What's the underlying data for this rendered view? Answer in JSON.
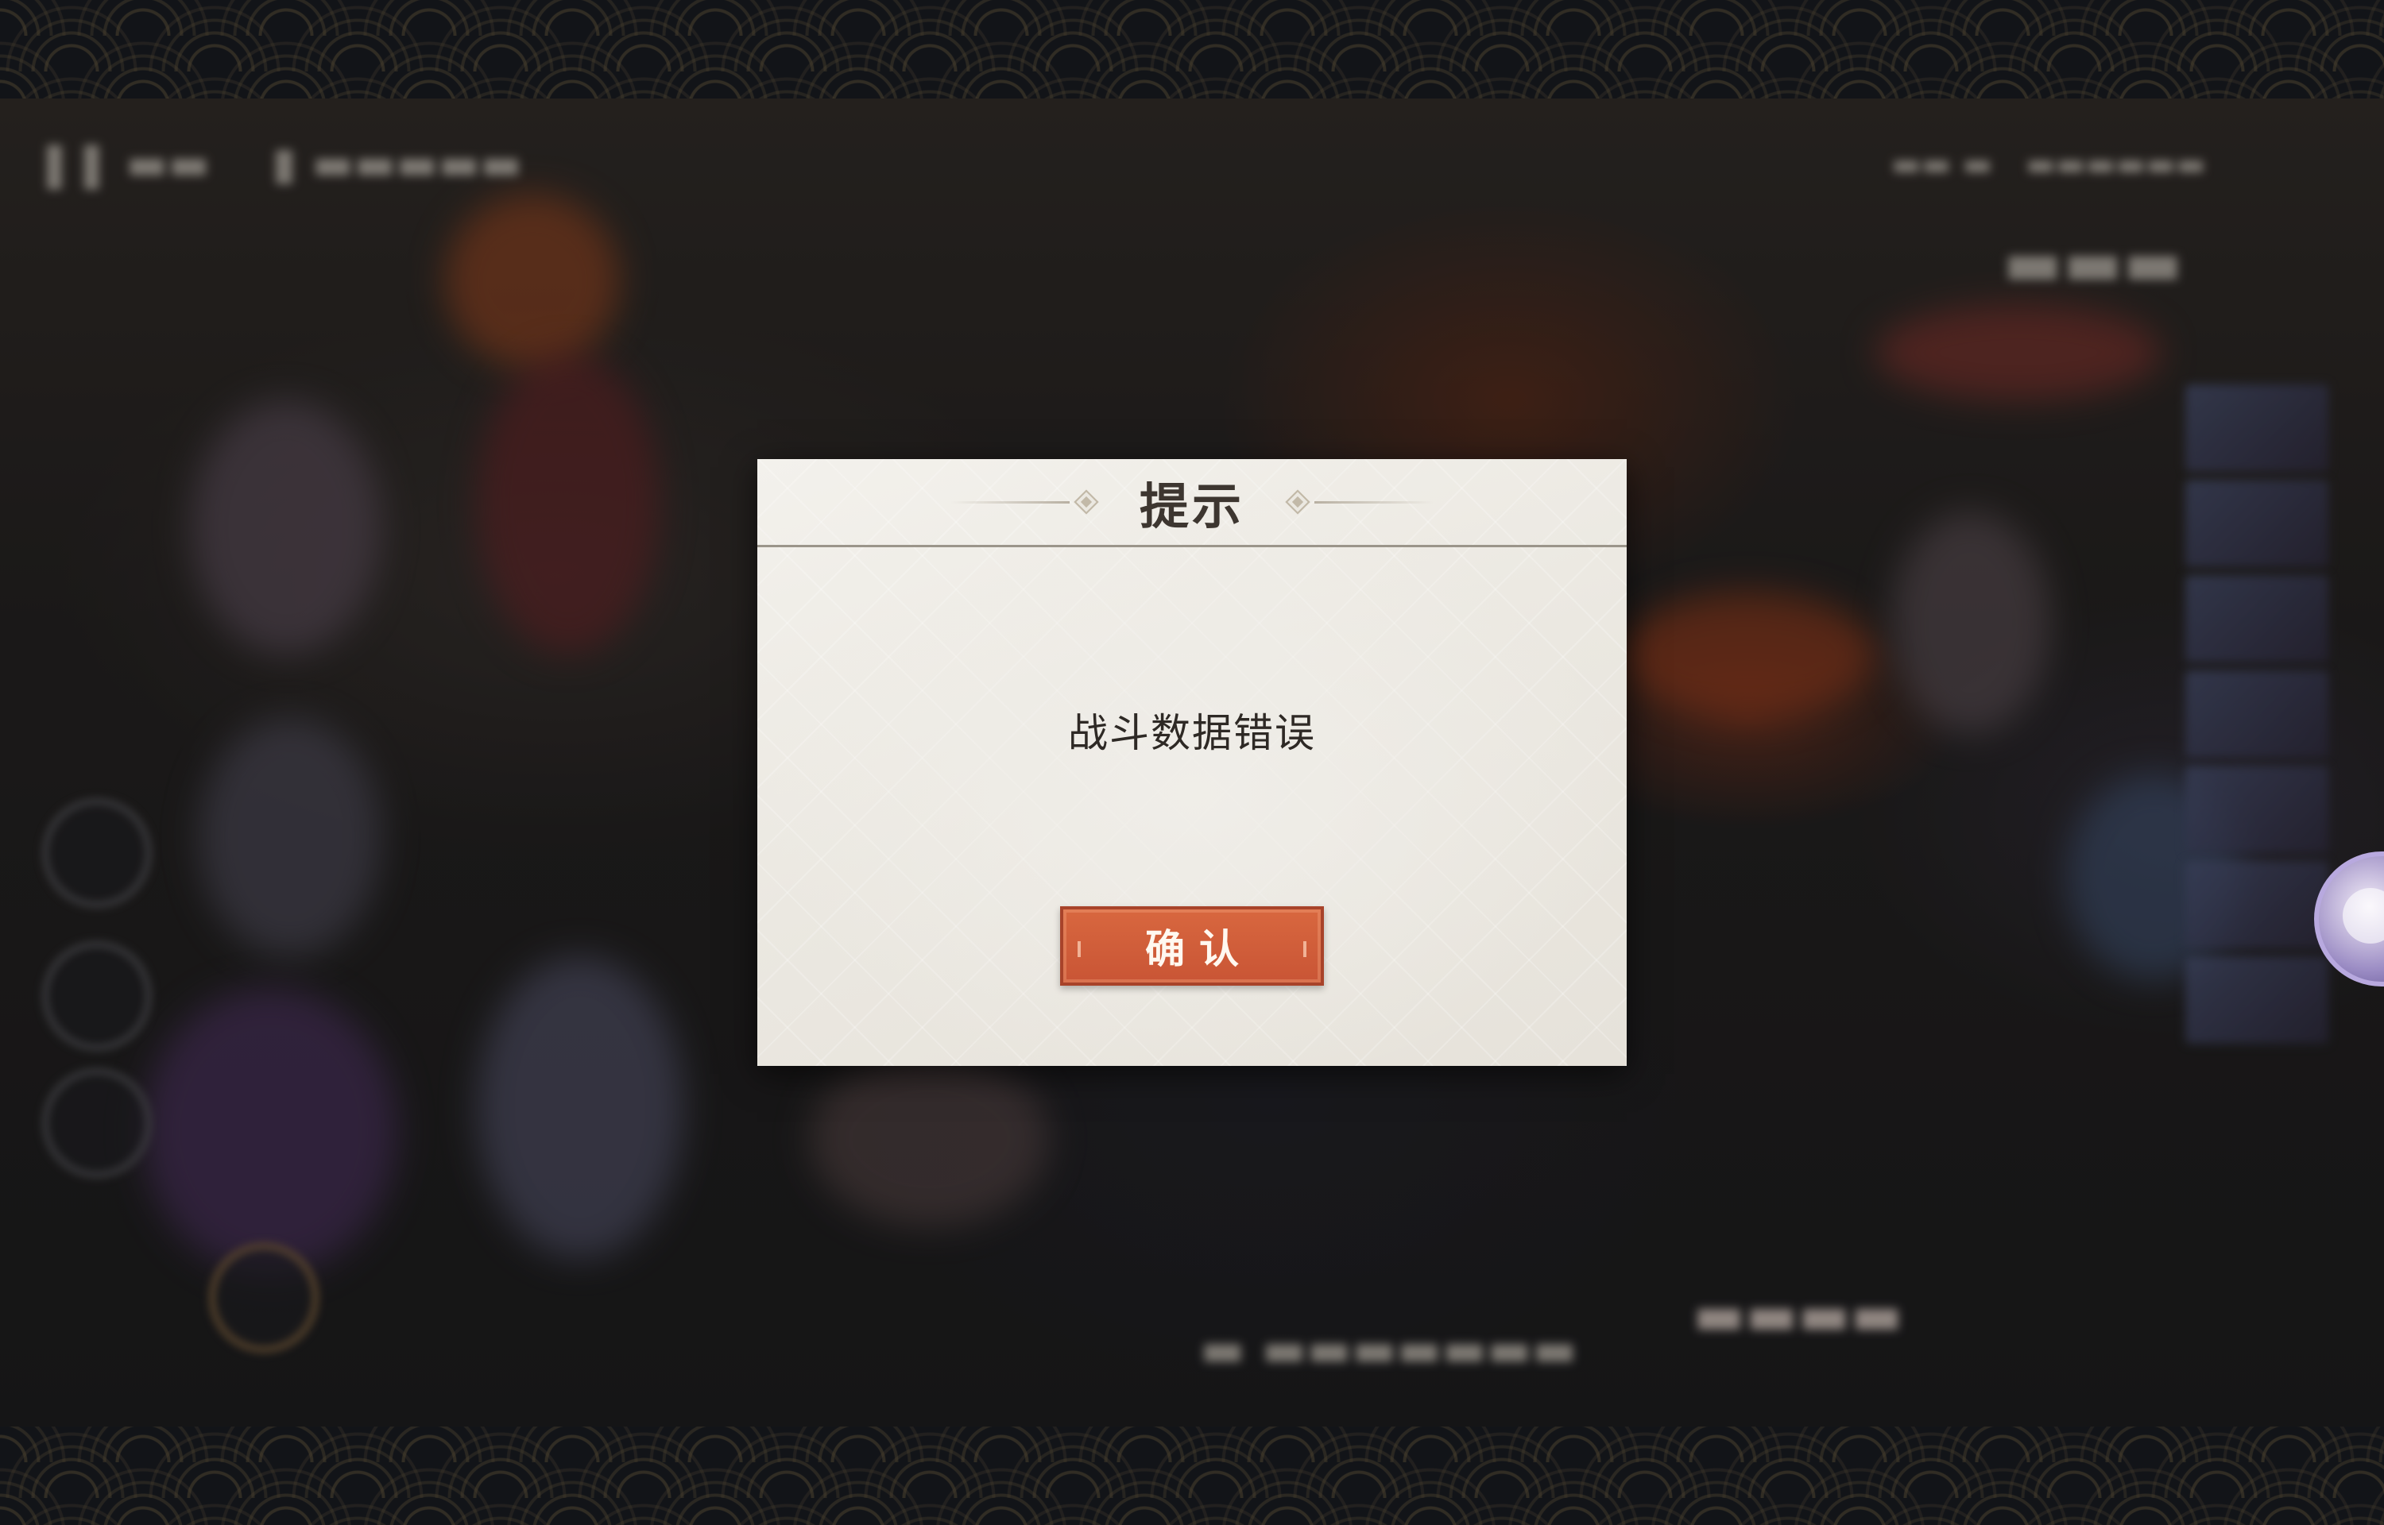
{
  "dialog": {
    "title": "提示",
    "message": "战斗数据错误",
    "confirm_label": "确认"
  },
  "colors": {
    "dialog_bg": "#ebe8e1",
    "title_text": "#3d3630",
    "button_bg": "#d0603a",
    "button_text": "#fff8f0"
  },
  "icons": [
    "pause-icon",
    "diamond-ornament-icon",
    "character-avatar-icon",
    "skill-button-icon"
  ]
}
